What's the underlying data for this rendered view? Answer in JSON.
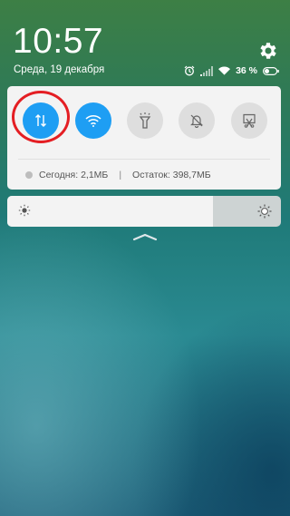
{
  "status_bar": {
    "time": "10:57",
    "date": "Среда, 19 декабря",
    "battery": "36 %",
    "icons": [
      "alarm-icon",
      "signal-icon",
      "wifi-icon",
      "battery-icon"
    ]
  },
  "quick_settings": {
    "tiles": [
      {
        "name": "mobile-data",
        "icon": "data-transfer-icon",
        "state": "on"
      },
      {
        "name": "wifi",
        "icon": "wifi-icon",
        "state": "on"
      },
      {
        "name": "flashlight",
        "icon": "flashlight-icon",
        "state": "off"
      },
      {
        "name": "silent",
        "icon": "bell-off-icon",
        "state": "off"
      },
      {
        "name": "screenshot",
        "icon": "screenshot-icon",
        "state": "off"
      }
    ],
    "highlight_tile": "mobile-data"
  },
  "data_usage": {
    "today": "Сегодня: 2,1МБ",
    "separator": "|",
    "remaining": "Остаток: 398,7МБ"
  },
  "brightness": {
    "level": 0.75
  },
  "colors": {
    "accent": "#1e9ef3",
    "highlight_ring": "#e41e23",
    "panel": "#f3f3f3"
  }
}
